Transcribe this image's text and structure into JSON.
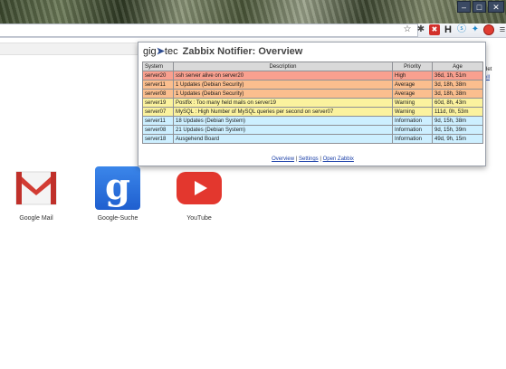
{
  "popup": {
    "brand_prefix": "gig",
    "brand_arrow": "➤",
    "brand_suffix": "tec",
    "title": "Zabbix Notifier: Overview",
    "table": {
      "headers": [
        "System",
        "Description",
        "Priority",
        "Age"
      ],
      "rows": [
        {
          "system": "server20",
          "description": "ssh server alive on server20",
          "priority": "High",
          "age": "36d, 1h, 51m",
          "level": "high"
        },
        {
          "system": "server11",
          "description": "1 Updates (Debian Security)",
          "priority": "Average",
          "age": "3d, 18h, 38m",
          "level": "average"
        },
        {
          "system": "server08",
          "description": "1 Updates (Debian Security)",
          "priority": "Average",
          "age": "3d, 18h, 38m",
          "level": "average"
        },
        {
          "system": "server19",
          "description": "Postfix : Too many held mails on server19",
          "priority": "Warning",
          "age": "60d, 8h, 43m",
          "level": "warning"
        },
        {
          "system": "server07",
          "description": "MySQL : High Number of MySQL queries per second on server07",
          "priority": "Warning",
          "age": "111d, 0h, 53m",
          "level": "warning"
        },
        {
          "system": "server11",
          "description": "18 Updates (Debian System)",
          "priority": "Information",
          "age": "9d, 15h, 38m",
          "level": "information"
        },
        {
          "system": "server08",
          "description": "21 Updates (Debian System)",
          "priority": "Information",
          "age": "9d, 15h, 39m",
          "level": "information"
        },
        {
          "system": "server18",
          "description": "Ausgehend Board",
          "priority": "Information",
          "age": "49d, 9h, 15m",
          "level": "information"
        }
      ]
    },
    "links": {
      "overview": "Overview",
      "settings": "Settings",
      "open_zabbix": "Open Zabbix",
      "separator": " | "
    }
  },
  "apps": [
    {
      "label": "Google Mail",
      "icon": "gmail-icon"
    },
    {
      "label": "Google-Suche",
      "icon": "google-search-icon",
      "glyph": "g"
    },
    {
      "label": "YouTube",
      "icon": "youtube-icon"
    }
  ],
  "side_text": {
    "line1": "det",
    "line2": "ell"
  },
  "toolbar": {
    "star_icon": "☆",
    "puzzle_icon": "✱",
    "red_icon": "✖",
    "h_icon": "H",
    "skype_icon": "ⓢ",
    "bluetooth_icon": "✦",
    "menu_icon": "≡"
  },
  "window": {
    "minimize": "–",
    "maximize": "□",
    "close": "✕"
  },
  "colors": {
    "high": "#f9a08f",
    "average": "#fbbe8e",
    "warning": "#fbf29e",
    "information": "#cdefff",
    "link": "#1a3fa8"
  }
}
